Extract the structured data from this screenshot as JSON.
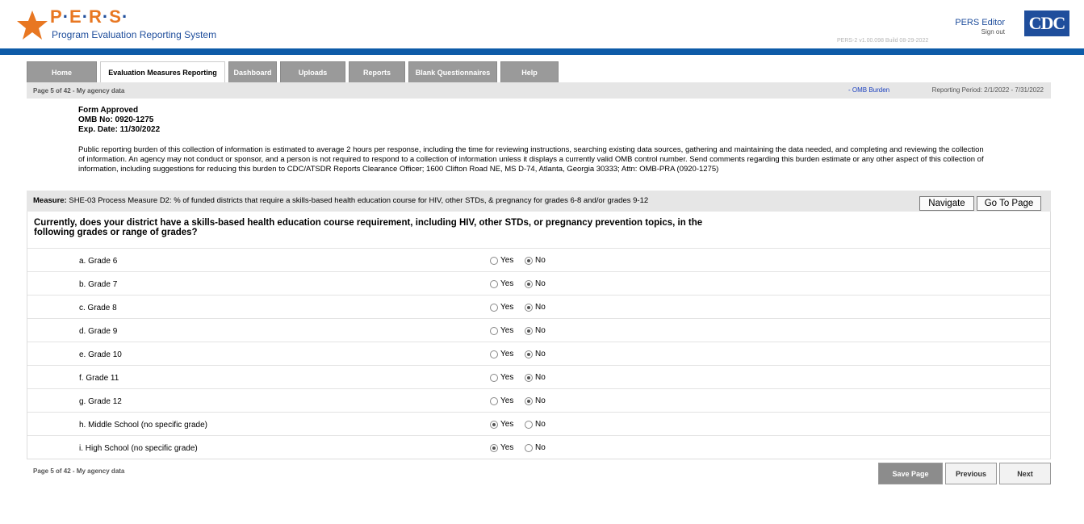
{
  "header": {
    "logo_letters": [
      "P",
      "E",
      "R",
      "S"
    ],
    "logo_subtitle": "Program Evaluation Reporting System",
    "user_role": "PERS Editor",
    "sign_out": "Sign out",
    "version": "PERS-2 v1.00.098   Build 08-29-2022",
    "cdc_logo": "CDC",
    "brand_orange": "#e87722",
    "brand_blue": "#0e5ba8"
  },
  "tabs": [
    {
      "label": "Home",
      "active": false
    },
    {
      "label": "Evaluation Measures Reporting",
      "active": true
    },
    {
      "label": "Dashboard",
      "active": false
    },
    {
      "label": "Uploads",
      "active": false
    },
    {
      "label": "Reports",
      "active": false
    },
    {
      "label": "Blank Questionnaires",
      "active": false
    },
    {
      "label": "Help",
      "active": false
    }
  ],
  "infobar": {
    "page_info": "Page 5 of 42 - My agency data",
    "omb_burden_link": "- OMB Burden",
    "reporting_period": "Reporting Period: 2/1/2022 - 7/31/2022"
  },
  "omb": {
    "line1": "Form Approved",
    "line2": "OMB No: 0920-1275",
    "line3": "Exp. Date: 11/30/2022"
  },
  "burden_statement": "Public reporting burden of this collection of information is estimated to average 2 hours per response, including the time for reviewing instructions, searching existing data sources, gathering and maintaining the data needed, and completing and reviewing the collection of information. An agency may not conduct or sponsor, and a person is not required to respond to a collection of information unless it displays a currently valid OMB control number. Send comments regarding this burden estimate or any other aspect of this collection of information, including suggestions for reducing this burden to CDC/ATSDR Reports Clearance Officer; 1600 Clifton Road NE, MS D-74, Atlanta, Georgia 30333; Attn: OMB-PRA (0920-1275)",
  "measure": {
    "label": "Measure:",
    "text": "SHE-03 Process Measure D2: % of funded districts that require a skills-based health education course for HIV, other STDs, & pregnancy for grades 6-8 and/or grades 9-12",
    "navigate_button": "Navigate",
    "goto_button": "Go To Page"
  },
  "question": "Currently, does your district have a skills-based health education course requirement, including HIV, other STDs, or pregnancy prevention topics, in the following grades or range of grades?",
  "options": {
    "yes": "Yes",
    "no": "No"
  },
  "rows": [
    {
      "label": "a. Grade 6",
      "answer": "No"
    },
    {
      "label": "b. Grade 7",
      "answer": "No"
    },
    {
      "label": "c. Grade 8",
      "answer": "No"
    },
    {
      "label": "d. Grade 9",
      "answer": "No"
    },
    {
      "label": "e. Grade 10",
      "answer": "No"
    },
    {
      "label": "f. Grade 11",
      "answer": "No"
    },
    {
      "label": "g. Grade 12",
      "answer": "No"
    },
    {
      "label": "h. Middle School (no specific grade)",
      "answer": "Yes"
    },
    {
      "label": "i. High School (no specific grade)",
      "answer": "Yes"
    }
  ],
  "footer": {
    "page_info": "Page 5 of 42 - My agency data",
    "save_button": "Save Page",
    "previous_button": "Previous",
    "next_button": "Next"
  }
}
